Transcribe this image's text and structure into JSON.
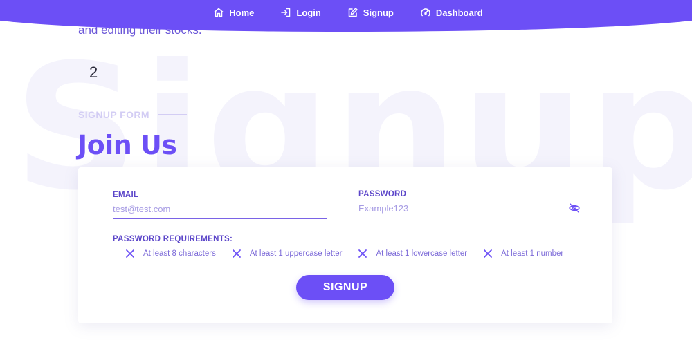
{
  "nav": {
    "items": [
      {
        "label": "Home",
        "icon": "home-icon"
      },
      {
        "label": "Login",
        "icon": "login-icon"
      },
      {
        "label": "Signup",
        "icon": "edit-icon"
      },
      {
        "label": "Dashboard",
        "icon": "speedometer-icon"
      }
    ]
  },
  "intro": {
    "text": "and editing their stocks."
  },
  "step": {
    "number": "2"
  },
  "watermark": {
    "text": "Signup"
  },
  "section": {
    "label": "SIGNUP FORM",
    "title": "Join Us"
  },
  "form": {
    "email": {
      "label": "EMAIL",
      "placeholder": "test@test.com",
      "value": ""
    },
    "password": {
      "label": "PASSWORD",
      "placeholder": "Example123",
      "value": ""
    },
    "requirements_title": "PASSWORD REQUIREMENTS:",
    "requirements": [
      {
        "text": "At least 8 characters",
        "met": false
      },
      {
        "text": "At least 1 uppercase letter",
        "met": false
      },
      {
        "text": "At least 1 lowercase letter",
        "met": false
      },
      {
        "text": "At least 1 number",
        "met": false
      }
    ],
    "submit_label": "SIGNUP"
  },
  "colors": {
    "accent": "#6c4ff6",
    "label": "#5b45c9",
    "muted": "#d3cdf4",
    "watermark": "#f4f3fc"
  }
}
